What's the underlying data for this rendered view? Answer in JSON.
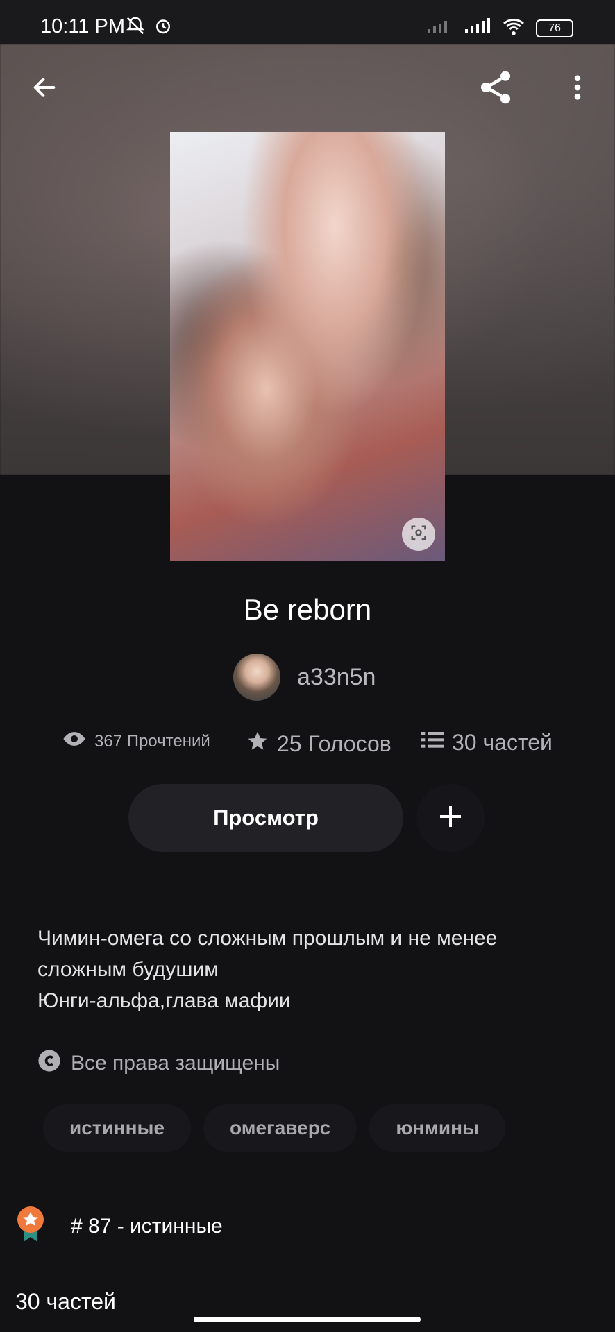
{
  "status_bar": {
    "time": "10:11 PM",
    "battery": "76"
  },
  "story": {
    "title": "Be reborn",
    "author": "a33n5n",
    "reads": "367 Прочтений",
    "votes": "25 Голосов",
    "parts": "30 частей"
  },
  "actions": {
    "view_label": "Просмотр"
  },
  "description": [
    "Чимин-омега со сложным прошлым и не менее сложным будушим",
    "Юнги-альфа,глава мафии"
  ],
  "copyright": "Все права защищены",
  "tags": [
    "истинные",
    "омегаверс",
    "юнмины"
  ],
  "ranking": "# 87 - истинные",
  "parts_heading": "30 частей",
  "colors": {
    "background": "#121114",
    "accent_badge": "#f07a3c",
    "badge_ribbon": "#2f8f86"
  }
}
